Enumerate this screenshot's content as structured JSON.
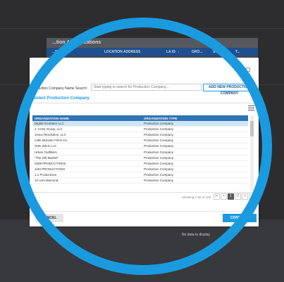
{
  "background_app": {
    "title": "...tion Authorizations",
    "columns": [
      "...RPOSE",
      "LOCATION ADDRESS",
      "LA ID",
      "↓",
      "GRO...",
      "STATUS",
      "T..."
    ],
    "empty_text": "No data to display"
  },
  "search": {
    "label": "Production Company Name Search:",
    "placeholder": "Start typing to search for Production Company..."
  },
  "add_button": "ADD NEW PRODUCTION COMPANY",
  "section_title": "Select Production Company",
  "table": {
    "headers": [
      "ORGANIZATION NAME",
      "ORGANIZATION TYPE"
    ],
    "rows": [
      {
        "name": "Digital Incubator LLC",
        "type": "Production Company"
      },
      {
        "name": "J. Crew Group, LLC",
        "type": "Production Company"
      },
      {
        "name": "Jesus Revolution, LLC",
        "type": "Production Company"
      },
      {
        "name": "Little Monster Films Inc.",
        "type": "Production Company"
      },
      {
        "name": "SHE WILD LLC",
        "type": "Production Company"
      },
      {
        "name": "Urban Outfitters",
        "type": "Production Company"
      },
      {
        "name": "\"The Gift Basket\"",
        "type": "Production Company"
      },
      {
        "name": "0308 PRODUCTIONS",
        "type": "Production Company"
      },
      {
        "name": "1/33 PRODUCTIONS",
        "type": "Production Company"
      },
      {
        "name": "1:1 Productions",
        "type": "Production Company"
      },
      {
        "name": "10 cent diamond",
        "type": "Production Company"
      }
    ]
  },
  "pagination": {
    "showing": "Showing 1-50 of 108",
    "first": "|<",
    "prev": "<",
    "current": "1",
    "next_page": "2",
    "next": ">",
    "last": ">|"
  },
  "footer": {
    "cancel": "CANCEL",
    "continue": "CONTINUE"
  },
  "colors": {
    "accent": "#1a9be0",
    "header_blue": "#2f74b5",
    "selected_row": "#cfe6f7"
  }
}
